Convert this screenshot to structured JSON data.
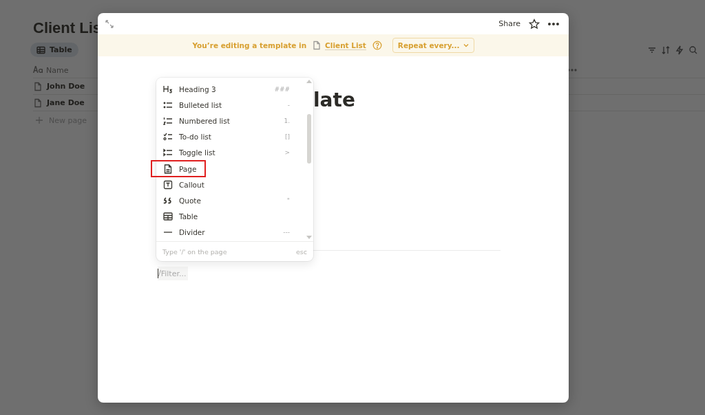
{
  "background_page": {
    "title": "Client Lis",
    "view_tab": {
      "label": "Table",
      "selected": true
    },
    "column_header": "Name",
    "rows": [
      "John Doe",
      "Jane Doe"
    ],
    "new_row": "New page"
  },
  "modal": {
    "share": "Share",
    "banner": {
      "text": "You’re editing a template in",
      "link": "Client List",
      "repeat_button": "Repeat every..."
    },
    "page_title": "late",
    "command_menu": {
      "items": [
        {
          "label": "Heading 3",
          "shortcut": "###",
          "highlighted": false
        },
        {
          "label": "Bulleted list",
          "shortcut": "-",
          "highlighted": false
        },
        {
          "label": "Numbered list",
          "shortcut": "1.",
          "highlighted": false
        },
        {
          "label": "To-do list",
          "shortcut": "[]",
          "highlighted": false
        },
        {
          "label": "Toggle list",
          "shortcut": ">",
          "highlighted": false
        },
        {
          "label": "Page",
          "highlighted": true
        },
        {
          "label": "Callout",
          "highlighted": false
        },
        {
          "label": "Quote",
          "shortcut": "\"",
          "highlighted": false
        },
        {
          "label": "Table",
          "highlighted": false
        },
        {
          "label": "Divider",
          "shortcut": "---",
          "highlighted": false
        }
      ],
      "footer_hint": "Type '/' on the page",
      "footer_key": "esc"
    },
    "filter": {
      "value": "/",
      "placeholder": "Filter..."
    }
  }
}
